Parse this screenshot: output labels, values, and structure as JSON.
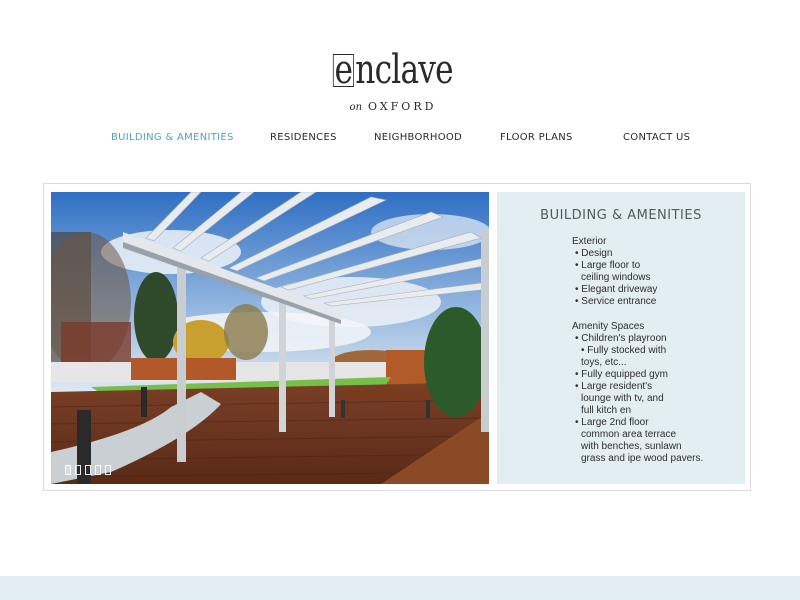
{
  "brand": {
    "logo_boxed_letter": "e",
    "logo_rest": "nclave",
    "logo_on": "on",
    "logo_sub": "OXFORD"
  },
  "nav": {
    "items": [
      {
        "label": "BUILDING & AMENITIES",
        "active": true
      },
      {
        "label": "RESIDENCES",
        "active": false
      },
      {
        "label": "NEIGHBORHOOD",
        "active": false
      },
      {
        "label": "FLOOR PLANS",
        "active": false
      },
      {
        "label": "CONTACT US",
        "active": false
      }
    ],
    "active_color": "#4fa3bd"
  },
  "slider": {
    "image_icon": "rooftop-pergola-photo",
    "total_slides": 5,
    "current_slide": 1
  },
  "info": {
    "title": "BUILDING & AMENITIES",
    "exterior": {
      "heading": "Exterior",
      "items": [
        "• Design",
        "• Large floor to",
        "ceiling windows",
        "• Elegant driveway",
        "• Service entrance"
      ]
    },
    "amenities": {
      "heading": "Amenity Spaces",
      "items": [
        "• Children's playroon",
        "• Fully stocked with",
        "toys, etc...",
        "• Fully equipped gym",
        "• Large resident's",
        "lounge with tv, and",
        "full kitch en",
        "• Large 2nd floor",
        "common area terrace",
        "with benches, sunlawn",
        "grass and ipe wood pavers."
      ]
    }
  },
  "colors": {
    "panel_bg": "#e2eef2",
    "footer_band": "#e2eef2"
  }
}
